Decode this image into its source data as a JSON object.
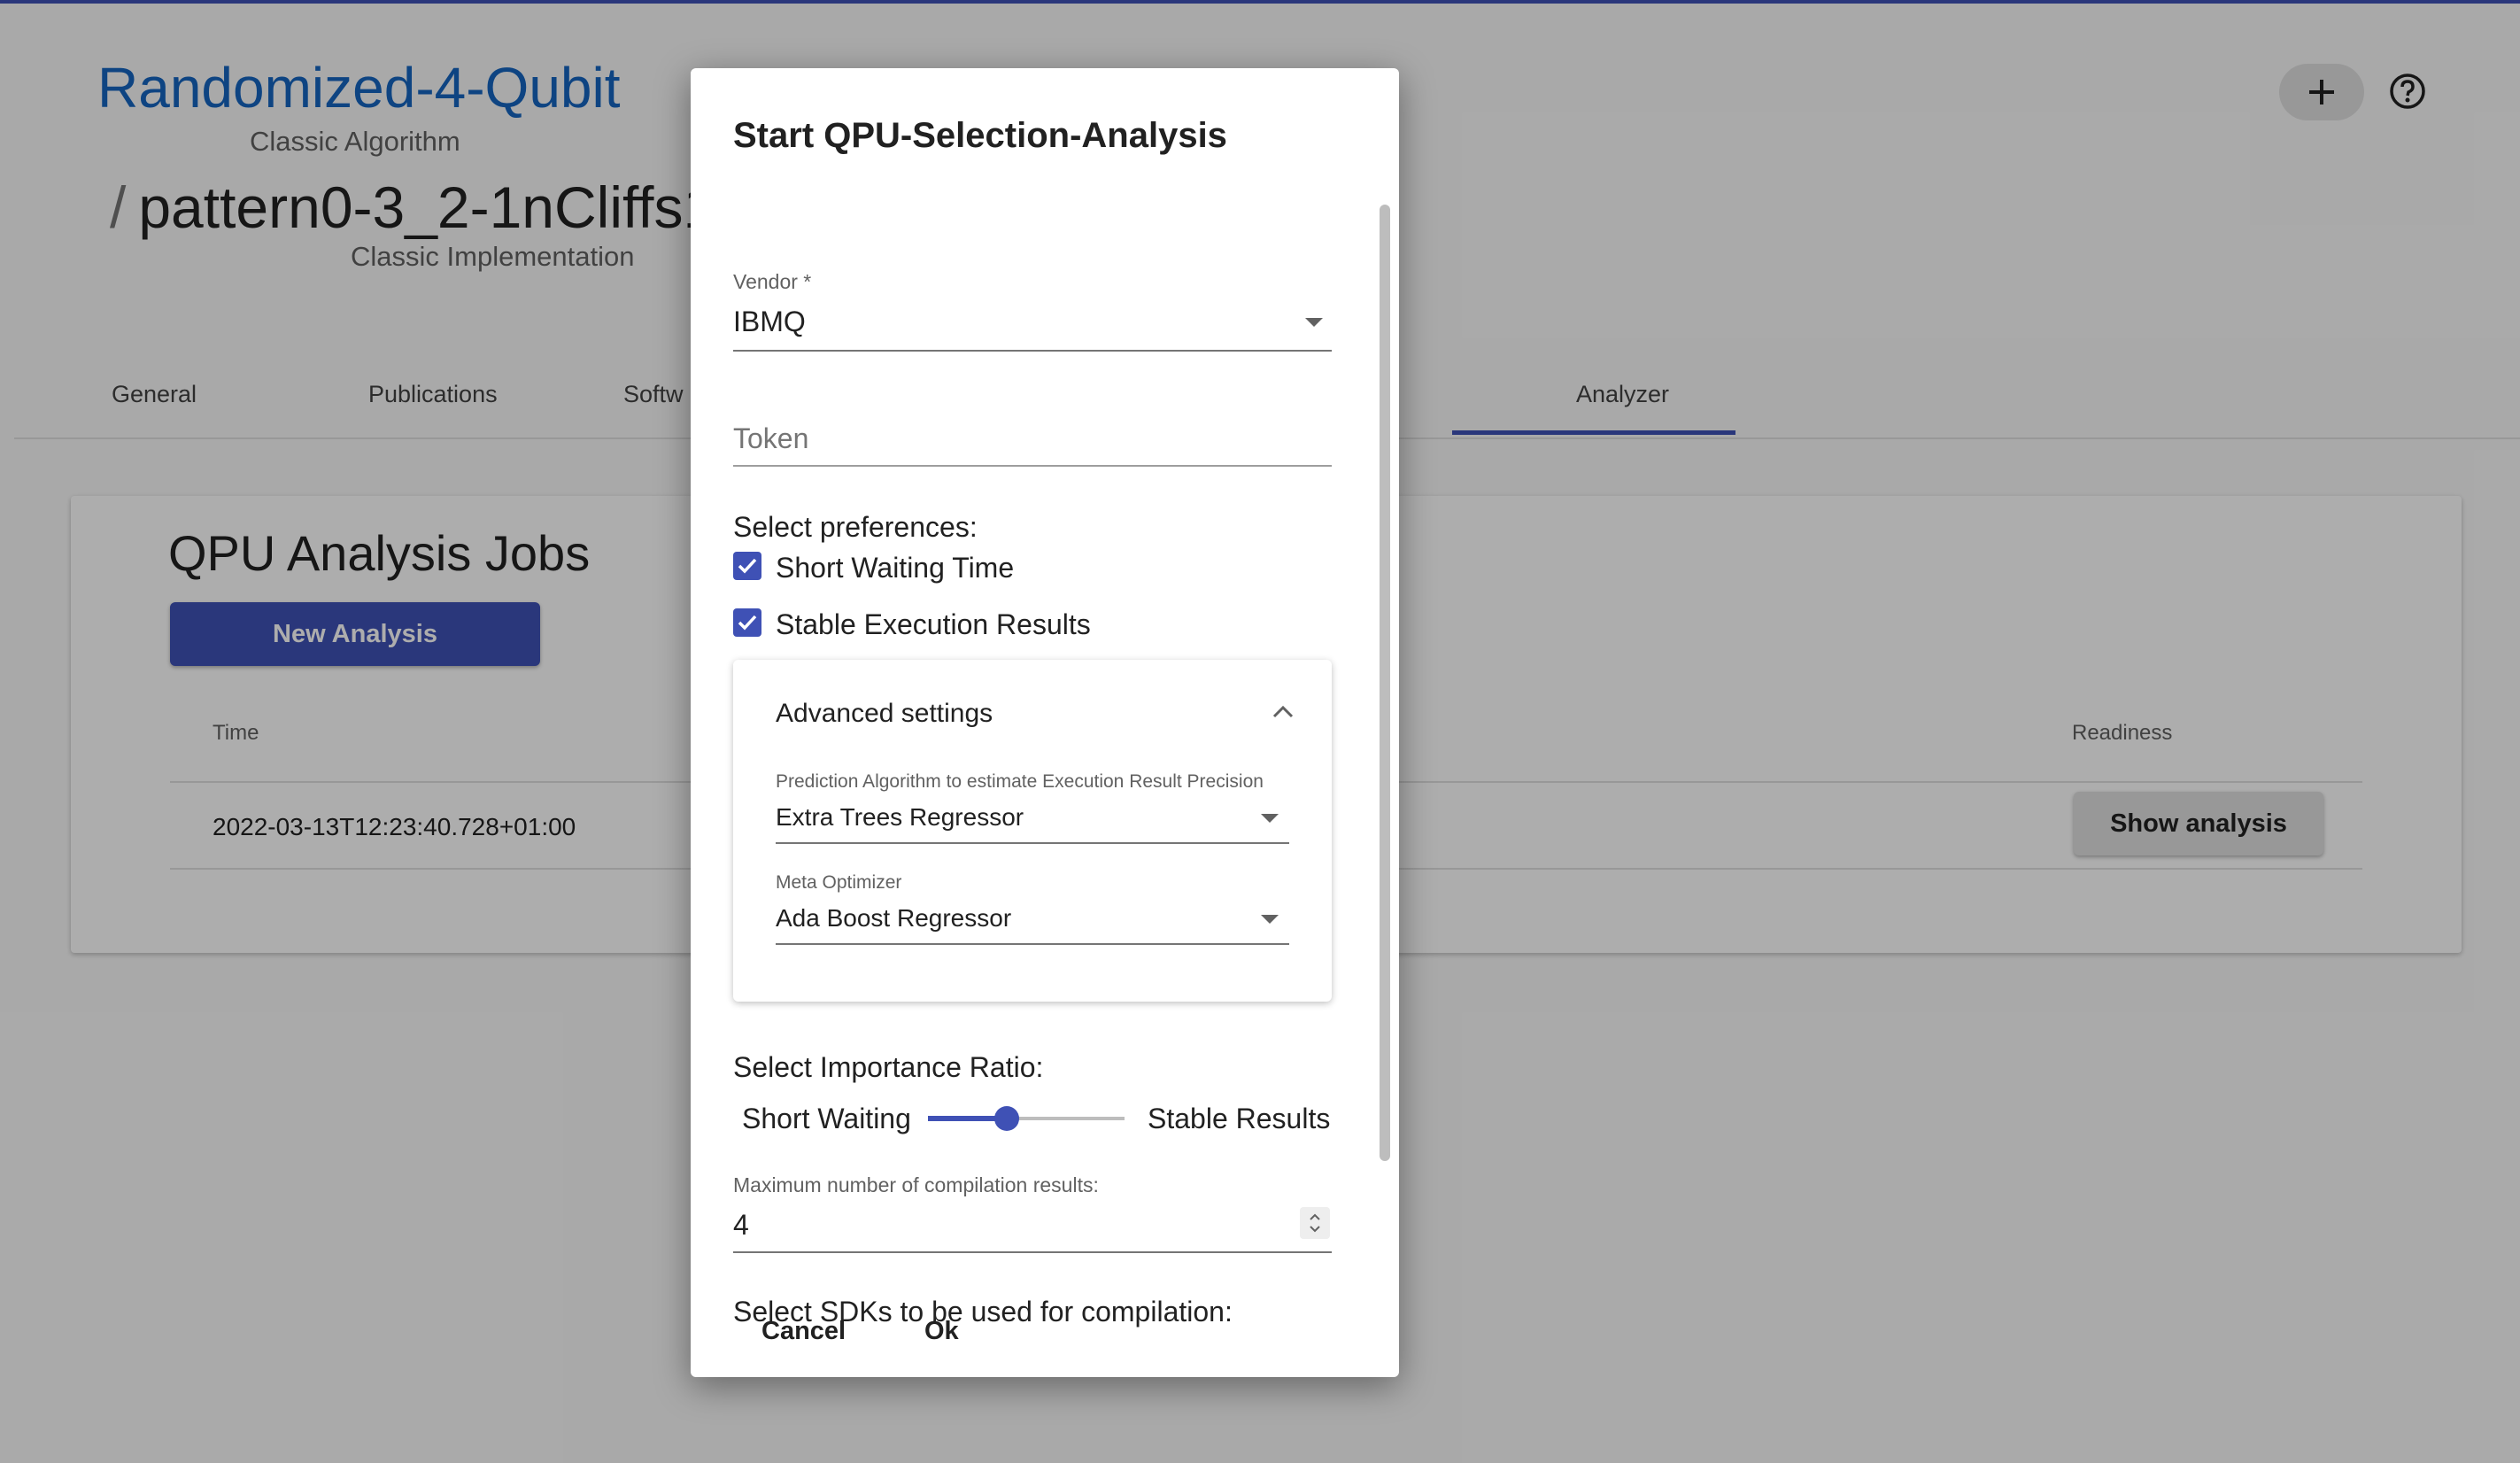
{
  "header": {
    "algorithm_title": "Randomized-4-Qubit",
    "algorithm_subtitle": "Classic Algorithm",
    "implementation_slash": "/",
    "implementation_title": "pattern0-3_2-1nCliffs1",
    "implementation_subtitle": "Classic Implementation"
  },
  "tabs": [
    {
      "label": "General"
    },
    {
      "label": "Publications"
    },
    {
      "label": "Softw"
    },
    {
      "label": "Analyzer"
    }
  ],
  "card": {
    "title": "QPU Analysis Jobs",
    "new_analysis_label": "New Analysis",
    "columns": {
      "time": "Time",
      "readiness": "Readiness"
    },
    "rows": [
      {
        "time": "2022-03-13T12:23:40.728+01:00",
        "action_label": "Show analysis"
      }
    ]
  },
  "dialog": {
    "title": "Start QPU-Selection-Analysis",
    "vendor": {
      "label": "Vendor *",
      "value": "IBMQ"
    },
    "token": {
      "placeholder": "Token"
    },
    "preferences": {
      "title": "Select preferences:",
      "items": [
        {
          "label": "Short Waiting Time",
          "checked": true
        },
        {
          "label": "Stable Execution Results",
          "checked": true
        }
      ]
    },
    "advanced": {
      "title": "Advanced settings",
      "prediction": {
        "label": "Prediction Algorithm to estimate Execution Result Precision",
        "value": "Extra Trees Regressor"
      },
      "meta_optimizer": {
        "label": "Meta Optimizer",
        "value": "Ada Boost Regressor"
      }
    },
    "importance": {
      "title": "Select Importance Ratio:",
      "left_label": "Short Waiting",
      "right_label": "Stable Results",
      "value_fraction": 0.4
    },
    "max_results": {
      "label": "Maximum number of compilation results:",
      "value": "4"
    },
    "sdks_title": "Select SDKs to be used for compilation:",
    "buttons": {
      "cancel": "Cancel",
      "ok": "Ok"
    }
  },
  "colors": {
    "primary": "#3f51b5",
    "link": "#1565c0"
  }
}
